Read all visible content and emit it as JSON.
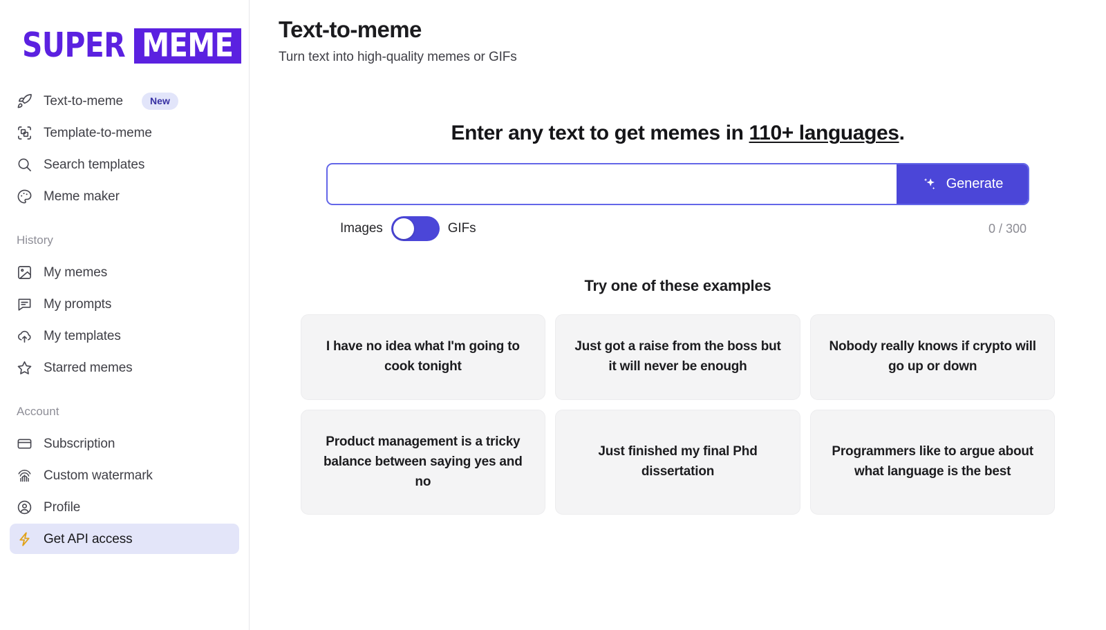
{
  "brand": {
    "name_part1": "SUPER",
    "name_part2": "MEME",
    "purple": "#5b21e0"
  },
  "sidebar": {
    "primary_items": [
      {
        "label": "Text-to-meme",
        "icon": "rocket-icon",
        "badge": "New",
        "active": false
      },
      {
        "label": "Template-to-meme",
        "icon": "scan-template-icon",
        "badge": "",
        "active": false
      },
      {
        "label": "Search templates",
        "icon": "search-icon",
        "badge": "",
        "active": false
      },
      {
        "label": "Meme maker",
        "icon": "palette-icon",
        "badge": "",
        "active": false
      }
    ],
    "history_label": "History",
    "history_items": [
      {
        "label": "My memes",
        "icon": "image-icon"
      },
      {
        "label": "My prompts",
        "icon": "message-icon"
      },
      {
        "label": "My templates",
        "icon": "cloud-upload-icon"
      },
      {
        "label": "Starred memes",
        "icon": "star-icon"
      }
    ],
    "account_label": "Account",
    "account_items": [
      {
        "label": "Subscription",
        "icon": "credit-card-icon",
        "active": false
      },
      {
        "label": "Custom watermark",
        "icon": "fingerprint-icon",
        "active": false
      },
      {
        "label": "Profile",
        "icon": "user-circle-icon",
        "active": false
      },
      {
        "label": "Get API access",
        "icon": "lightning-bolt-icon",
        "active": true
      }
    ]
  },
  "header": {
    "title": "Text-to-meme",
    "subtitle": "Turn text into high-quality memes or GIFs"
  },
  "hero": {
    "heading_before": "Enter any text to get memes in ",
    "heading_link": "110+ languages",
    "heading_after": "."
  },
  "prompt": {
    "value": "",
    "placeholder": "",
    "generate_label": "Generate",
    "generate_color": "#4b46d8"
  },
  "toggle": {
    "left_label": "Images",
    "right_label": "GIFs",
    "selected": "Images",
    "track_color": "#4b46d8"
  },
  "counter": {
    "text": "0 / 300"
  },
  "examples": {
    "title": "Try one of these examples",
    "items": [
      "I have no idea what I'm going to cook tonight",
      "Just got a raise from the boss but it will never be enough",
      "Nobody really knows if crypto will go up or down",
      "Product management is a tricky balance between saying yes and no",
      "Just finished my final Phd dissertation",
      "Programmers like to argue about what language is the best"
    ]
  }
}
